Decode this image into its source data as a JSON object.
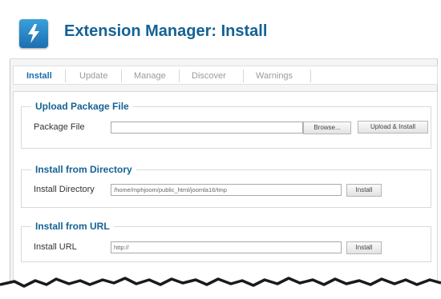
{
  "header": {
    "title": "Extension Manager: Install",
    "logo_icon": "joomla-extension-icon",
    "accent_color": "#146295"
  },
  "tabs": [
    {
      "label": "Install",
      "active": true
    },
    {
      "label": "Update",
      "active": false
    },
    {
      "label": "Manage",
      "active": false
    },
    {
      "label": "Discover",
      "active": false
    },
    {
      "label": "Warnings",
      "active": false
    }
  ],
  "upload": {
    "legend": "Upload Package File",
    "label": "Package File",
    "value": "",
    "browse_label": "Browse...",
    "submit_label": "Upload & Install"
  },
  "directory": {
    "legend": "Install from Directory",
    "label": "Install Directory",
    "value": "/home/mphjoom/public_html/joomla16/tmp",
    "submit_label": "Install"
  },
  "url": {
    "legend": "Install from URL",
    "label": "Install URL",
    "value": "http://",
    "submit_label": "Install"
  }
}
